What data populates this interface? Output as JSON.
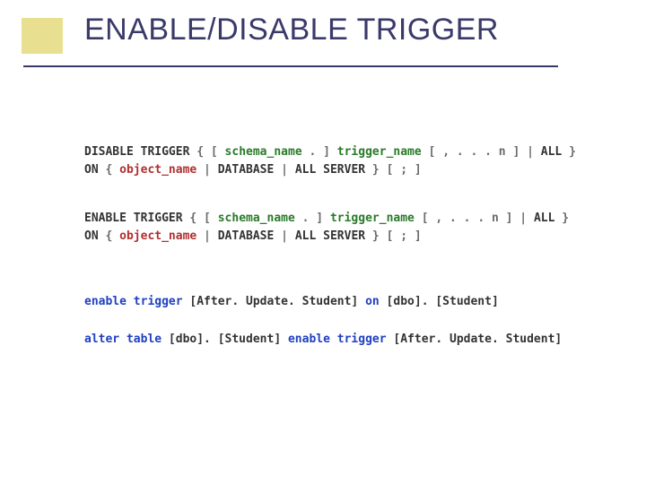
{
  "title": "ENABLE/DISABLE TRIGGER",
  "syntax": {
    "disable": {
      "l1_a": "DISABLE TRIGGER",
      "l1_b": " { [ ",
      "l1_c": "schema_name",
      "l1_d": " . ] ",
      "l1_e": "trigger_name",
      "l1_f": " [ ",
      "l1_g": ", . . . n",
      "l1_h": " ] | ",
      "l1_i": "ALL",
      "l1_j": " } ",
      "l2_a": "ON",
      "l2_b": " { ",
      "l2_c": "object_name",
      "l2_d": " | ",
      "l2_e": "DATABASE",
      "l2_f": " | ",
      "l2_g": "ALL SERVER",
      "l2_h": " } [ ; ]"
    },
    "enable": {
      "l1_a": "ENABLE TRIGGER",
      "l1_b": " { [ ",
      "l1_c": "schema_name",
      "l1_d": " . ] ",
      "l1_e": "trigger_name",
      "l1_f": " [ ",
      "l1_g": ", . . . n",
      "l1_h": " ] | ",
      "l1_i": "ALL",
      "l1_j": " } ",
      "l2_a": "ON",
      "l2_b": " { ",
      "l2_c": "object_name",
      "l2_d": " | ",
      "l2_e": "DATABASE",
      "l2_f": " | ",
      "l2_g": "ALL SERVER",
      "l2_h": " } [ ; ]"
    }
  },
  "examples": {
    "ex1_a": "enable trigger",
    "ex1_b": " [After. Update. Student] ",
    "ex1_c": "on",
    "ex1_d": " [dbo]. [Student]",
    "ex2_a": "alter table",
    "ex2_b": " [dbo]. [Student] ",
    "ex2_c": "enable trigger",
    "ex2_d": " [After. Update. Student]"
  }
}
